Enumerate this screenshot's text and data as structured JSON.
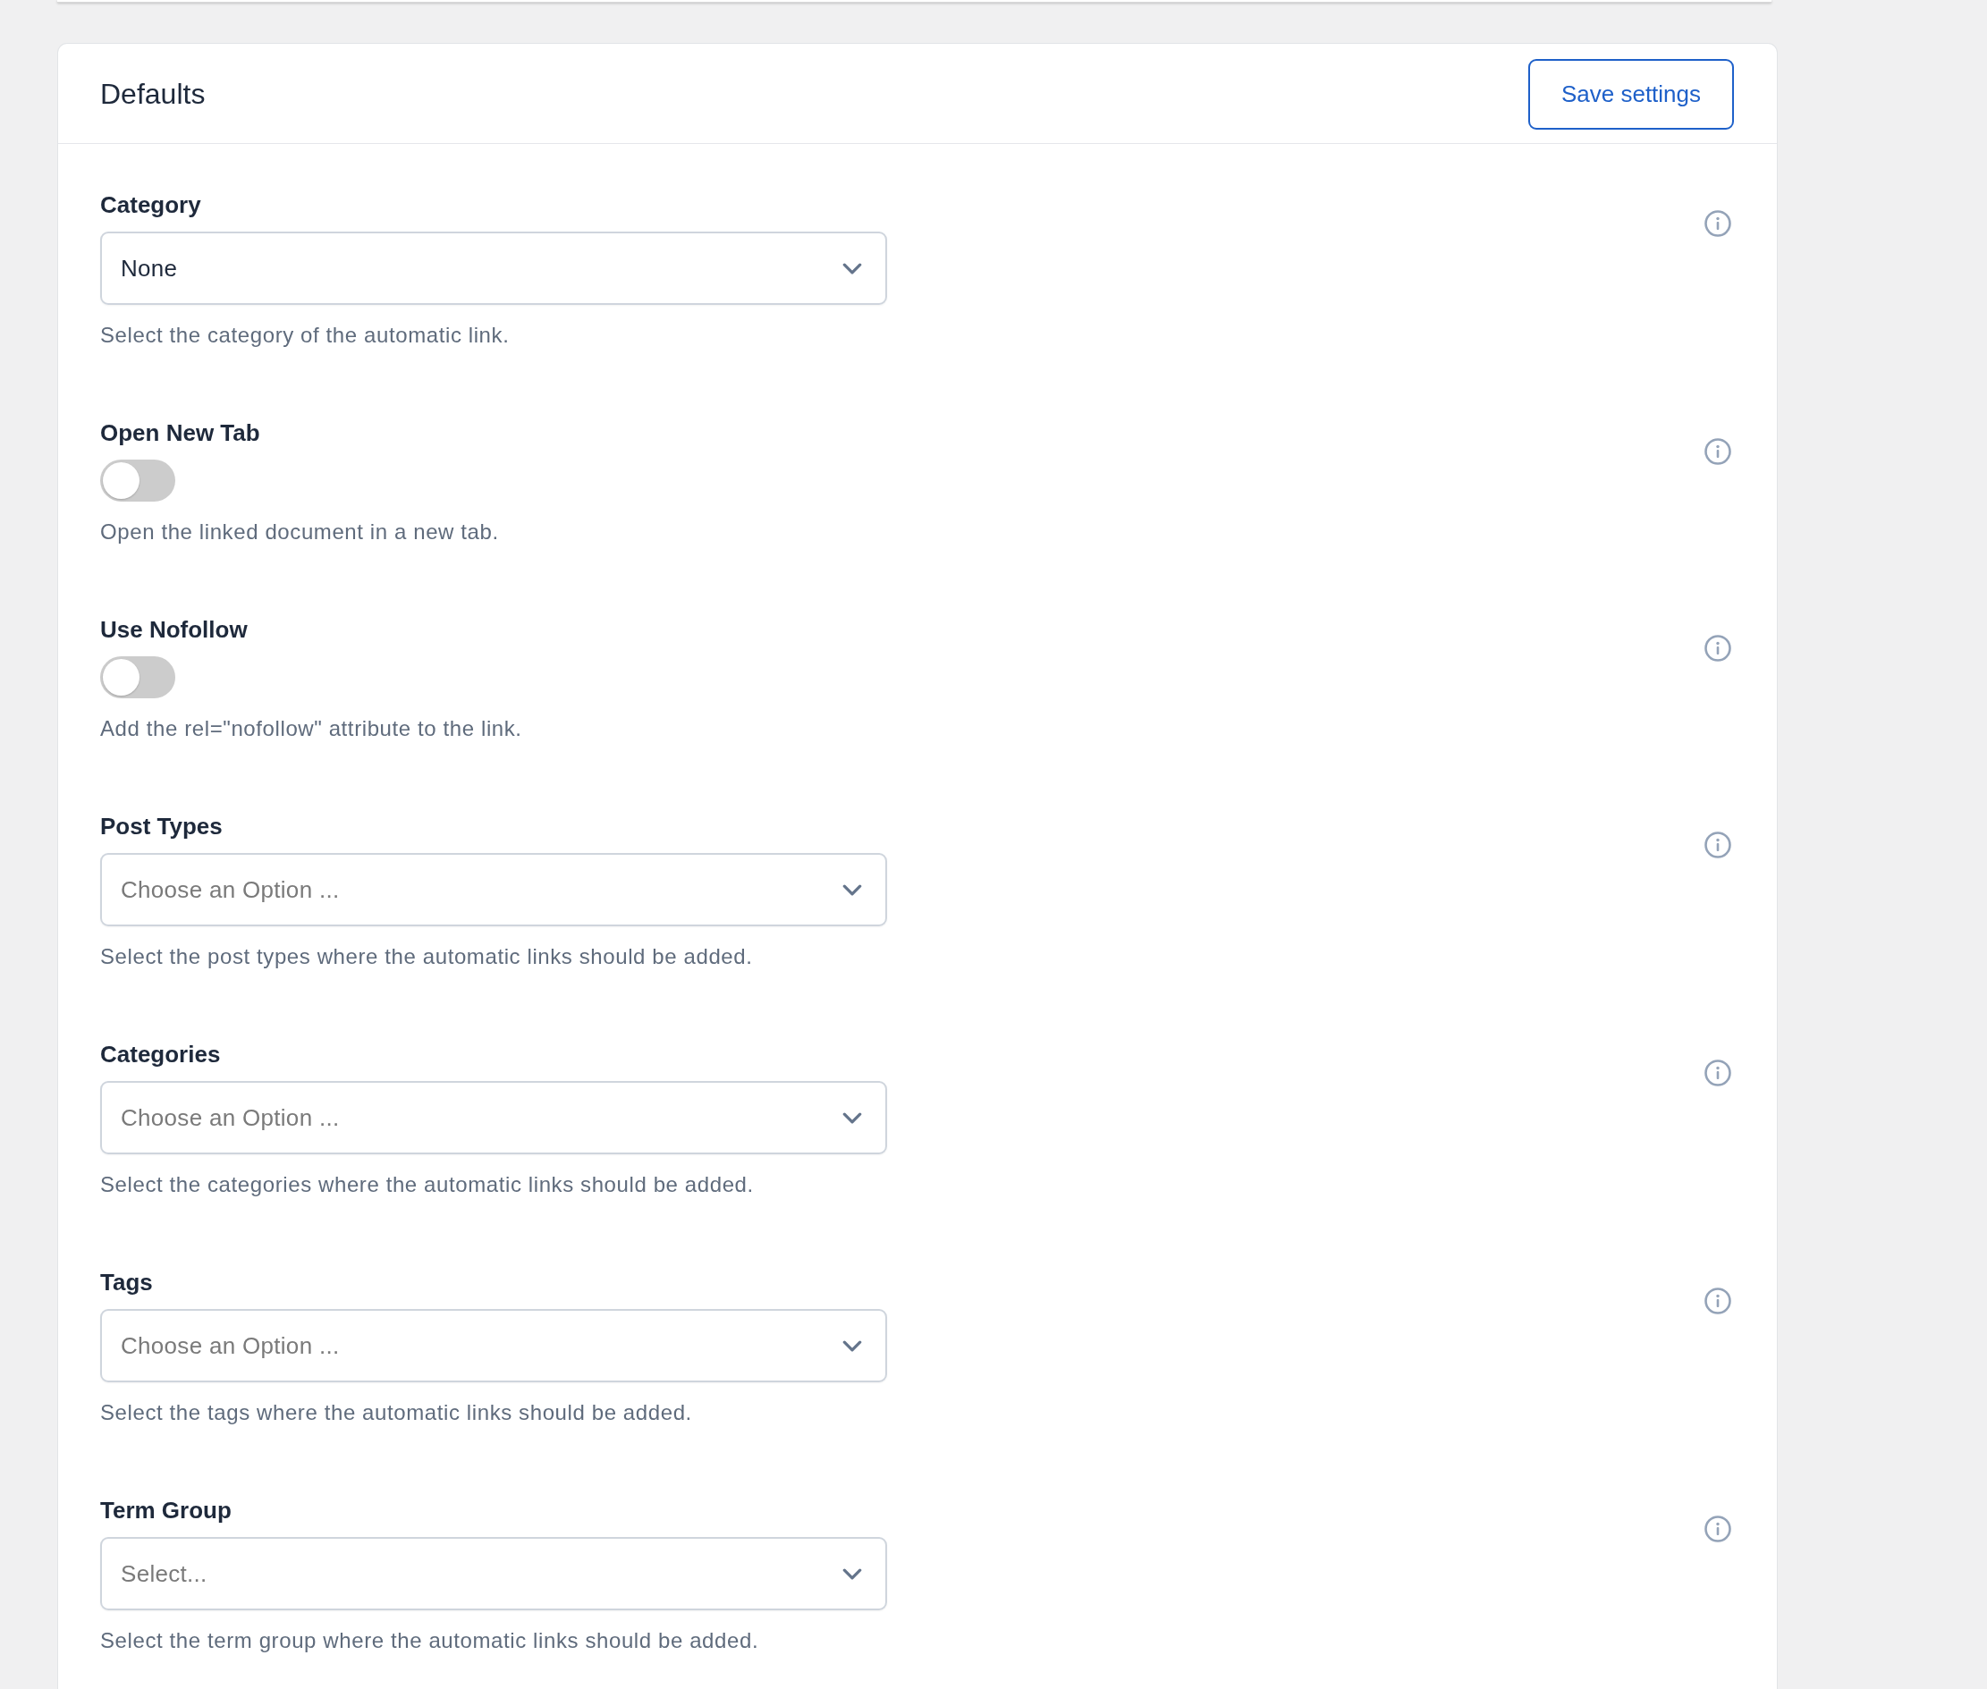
{
  "panel": {
    "title": "Defaults",
    "save_button": "Save settings"
  },
  "fields": [
    {
      "kind": "select",
      "label": "Category",
      "value": "None",
      "description": "Select the category of the automatic link."
    },
    {
      "kind": "toggle",
      "label": "Open New Tab",
      "on": false,
      "description": "Open the linked document in a new tab."
    },
    {
      "kind": "toggle",
      "label": "Use Nofollow",
      "on": false,
      "description": "Add the rel=\"nofollow\" attribute to the link."
    },
    {
      "kind": "select",
      "label": "Post Types",
      "placeholder": "Choose an Option ...",
      "description": "Select the post types where the automatic links should be added."
    },
    {
      "kind": "select",
      "label": "Categories",
      "placeholder": "Choose an Option ...",
      "description": "Select the categories where the automatic links should be added."
    },
    {
      "kind": "select",
      "label": "Tags",
      "placeholder": "Choose an Option ...",
      "description": "Select the tags where the automatic links should be added."
    },
    {
      "kind": "select",
      "label": "Term Group",
      "placeholder": "Select...",
      "description": "Select the term group where the automatic links should be added."
    }
  ]
}
